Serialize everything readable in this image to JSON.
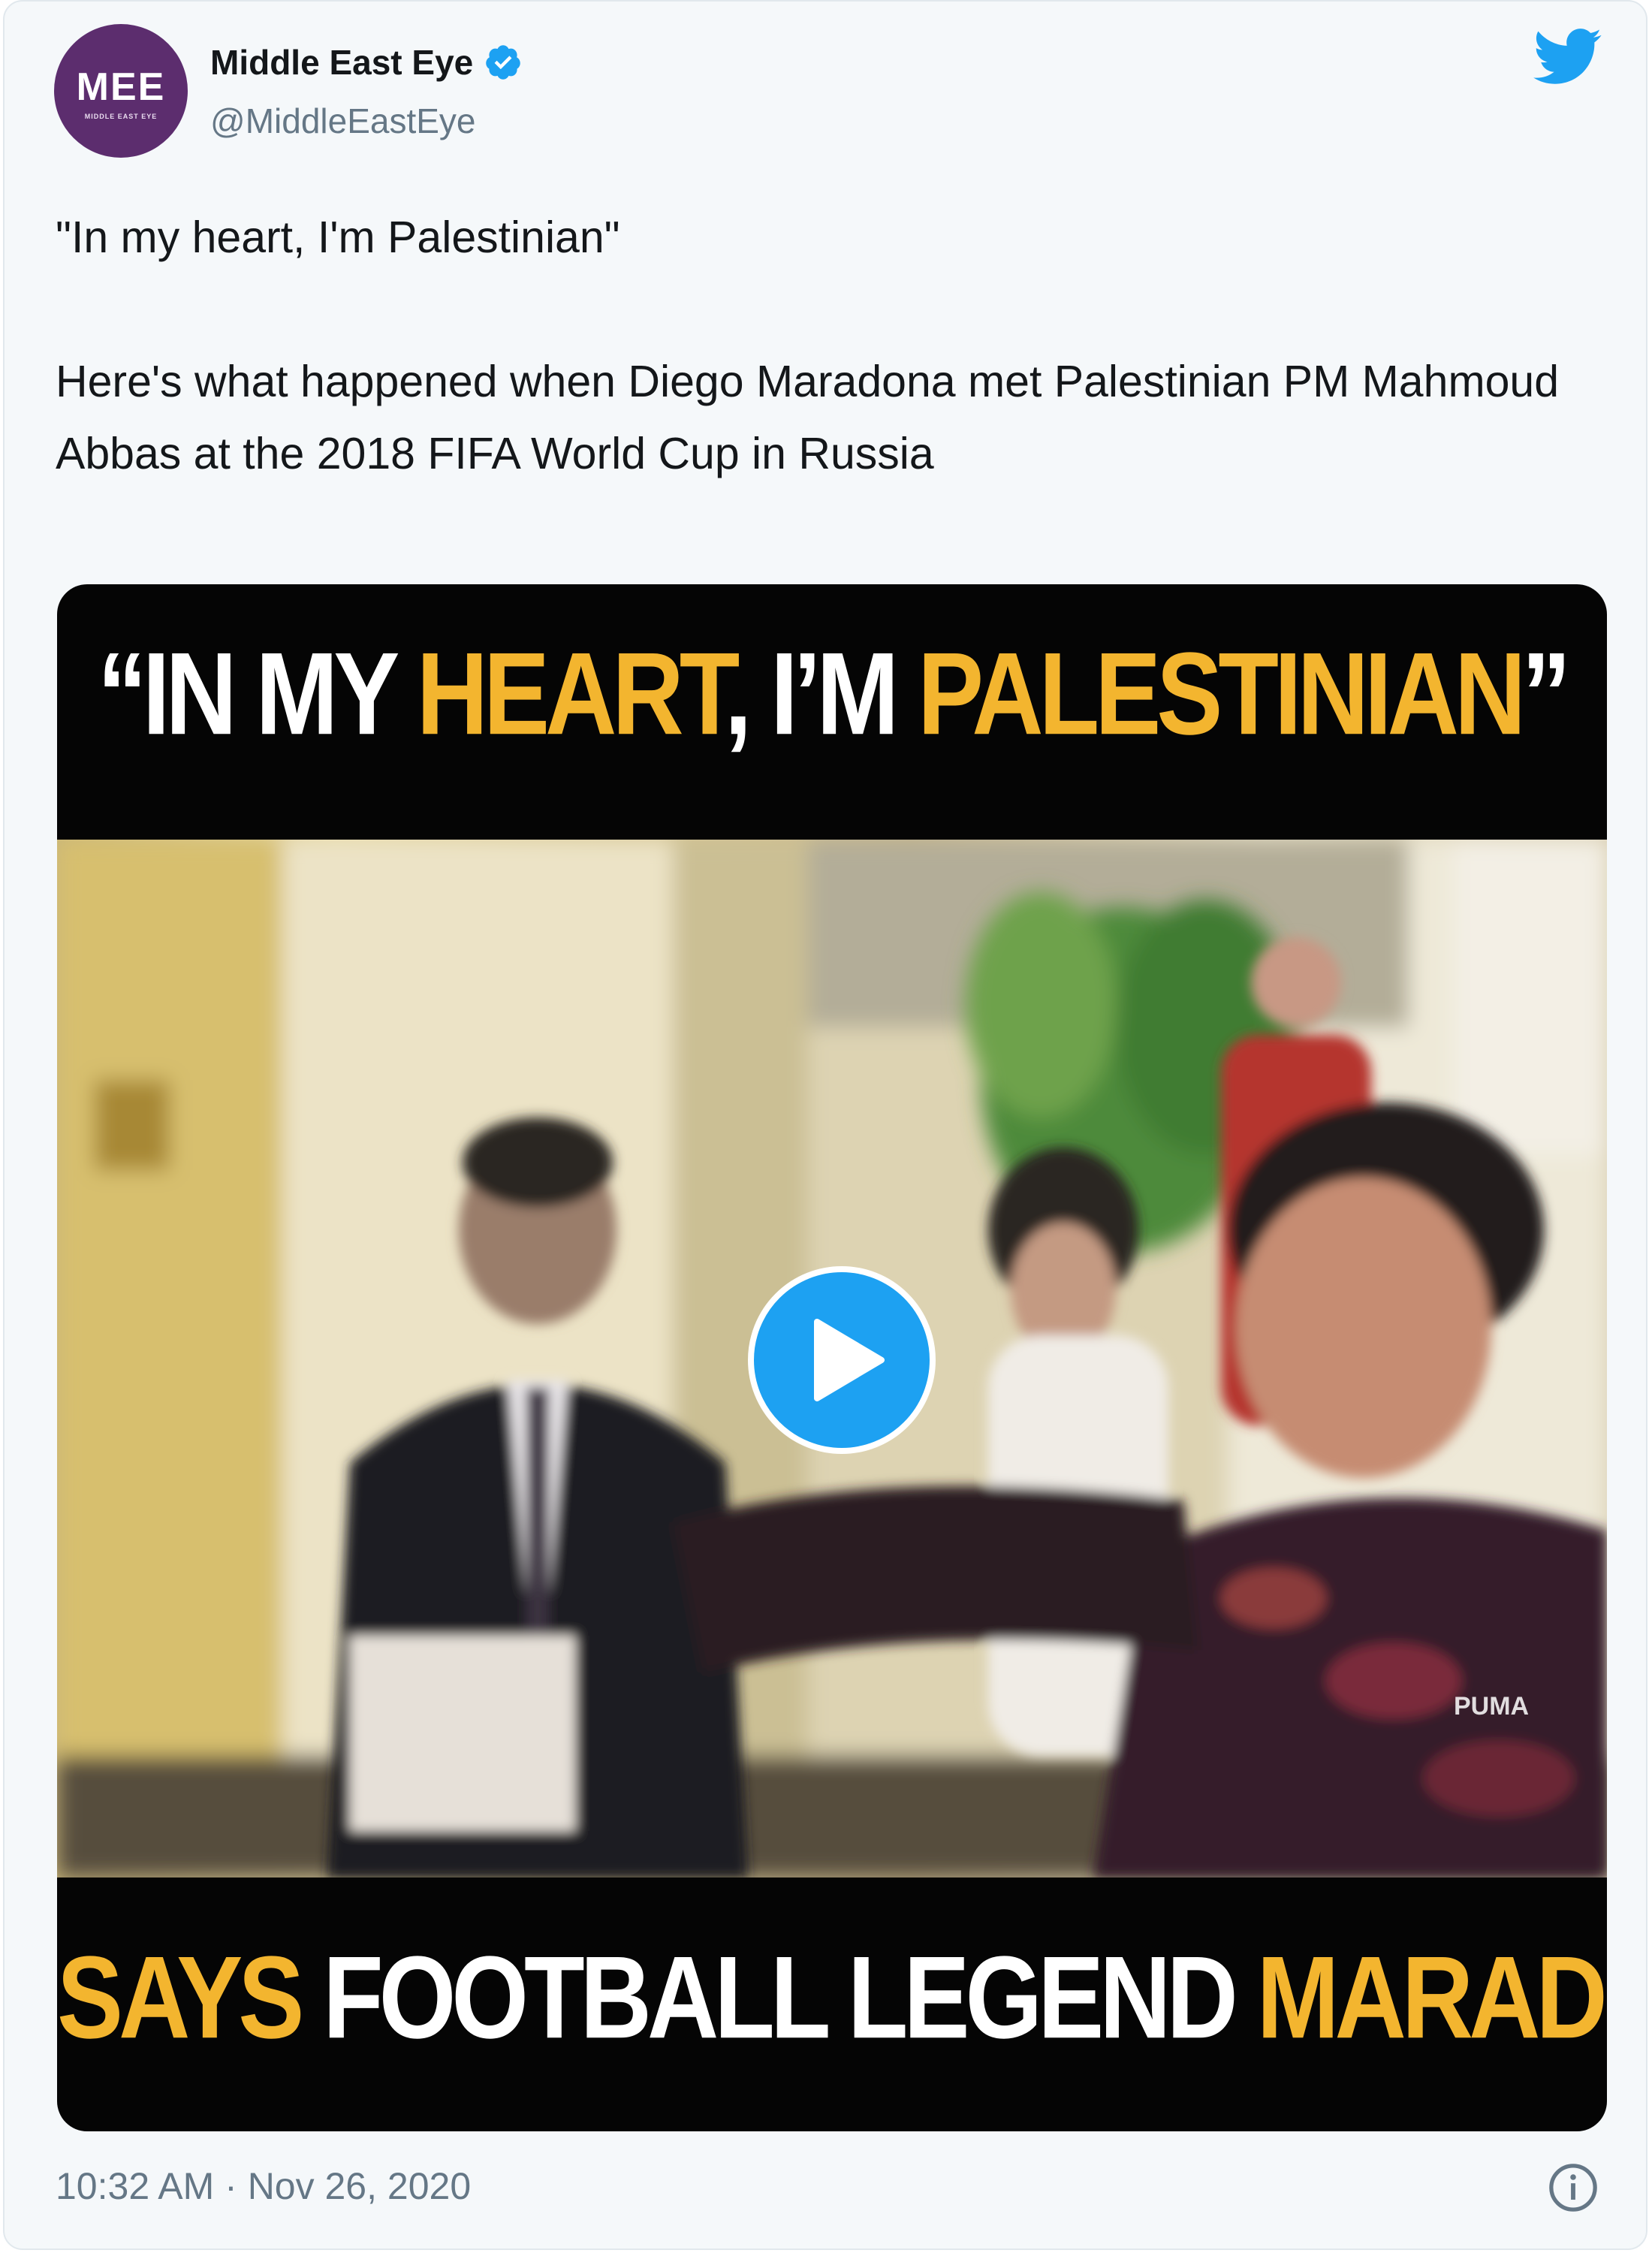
{
  "account": {
    "name": "Middle East Eye",
    "handle": "@MiddleEastEye",
    "avatar_text": "MEE",
    "avatar_tagline": "MIDDLE EAST EYE",
    "verified": true
  },
  "tweet": {
    "quote": "\"In my heart, I'm Palestinian\"",
    "body": "Here's what happened when Diego Maradona met Palestinian PM Mahmoud Abbas at the 2018 FIFA World Cup in Russia"
  },
  "video": {
    "headline": {
      "open_quote": "“",
      "part1": "IN MY ",
      "part2": "HEART",
      "part3": ", I’M ",
      "part4": "PALESTINIAN",
      "close_quote": "”"
    },
    "subline": {
      "part1": "SAYS ",
      "part2": "FOOTBALL LEGEND ",
      "part3": "MARADONA"
    },
    "jersey_text": "PUMA"
  },
  "footer": {
    "timestamp": "10:32 AM · Nov 26, 2020"
  },
  "icons": {
    "verified": "verified-badge-icon",
    "brand": "twitter-bird-icon",
    "play": "play-icon",
    "info": "info-icon"
  },
  "colors": {
    "twitter_blue": "#1da1f2",
    "caption_gold": "#f3b52f",
    "avatar_purple": "#5c2d6e",
    "secondary_text": "#657786"
  }
}
